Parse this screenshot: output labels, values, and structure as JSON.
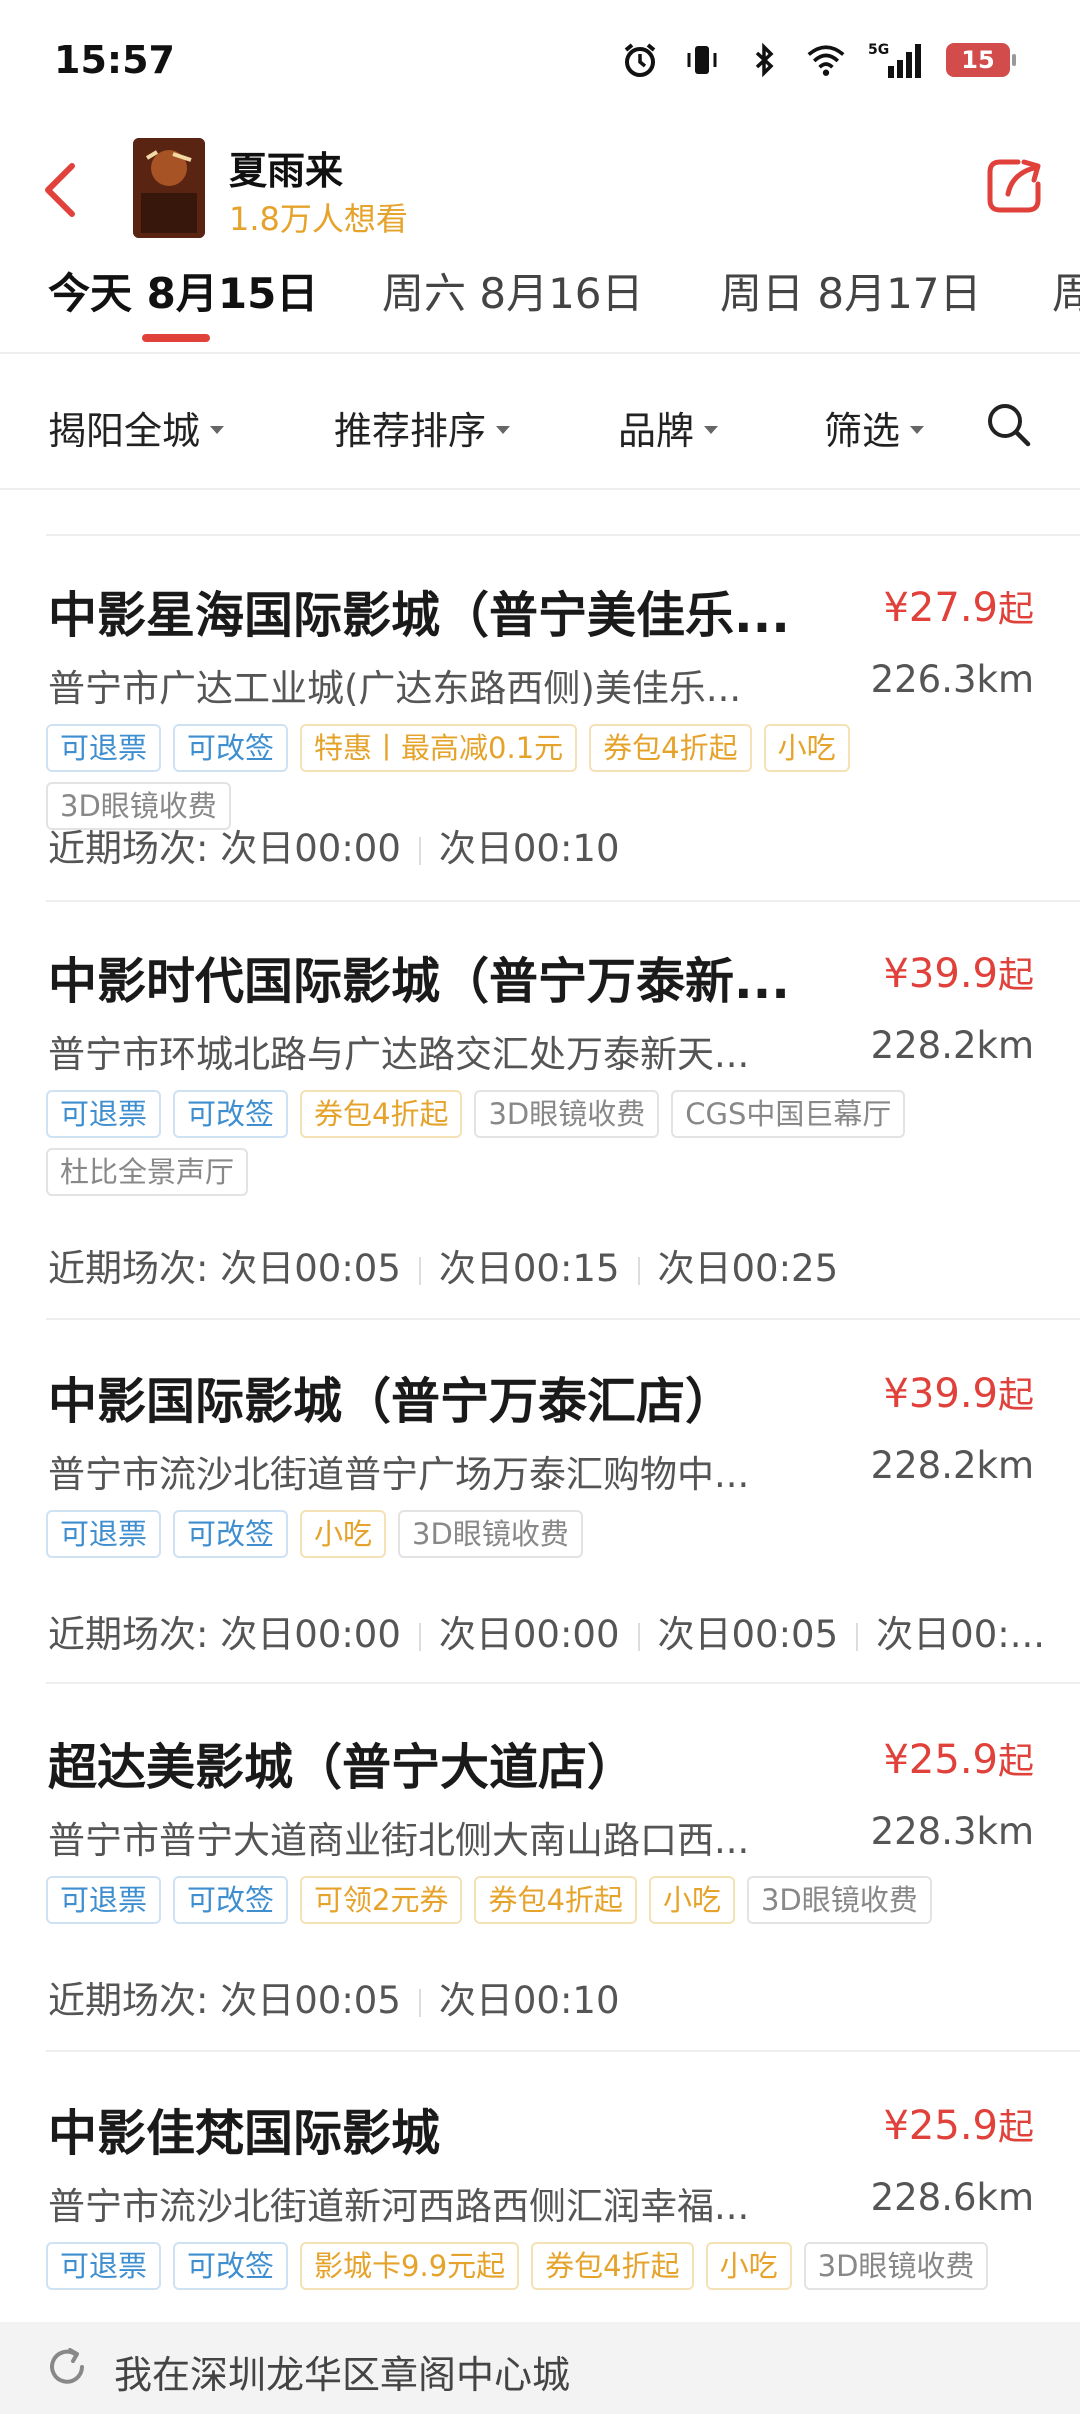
{
  "status_bar": {
    "time": "15:57",
    "battery": "15",
    "icons": [
      "alarm-icon",
      "vibrate-icon",
      "bluetooth-icon",
      "wifi-icon",
      "signal-5g-icon",
      "battery-icon"
    ]
  },
  "header": {
    "title": "夏雨来",
    "want_count": "1.8万人想看",
    "accent_color": "#e0413a"
  },
  "date_tabs": [
    {
      "label": "今天 8月15日",
      "active": true
    },
    {
      "label": "周六 8月16日",
      "active": false
    },
    {
      "label": "周日 8月17日",
      "active": false
    },
    {
      "label": "周",
      "active": false
    }
  ],
  "filters": {
    "area": "揭阳全城",
    "sort": "推荐排序",
    "brand": "品牌",
    "screen": "筛选"
  },
  "cinemas": [
    {
      "name": "中影星海国际影城（普宁美佳乐...",
      "price": "¥27.9",
      "price_suffix": "起",
      "address": "普宁市广达工业城(广达东路西侧)美佳乐...",
      "distance": "226.3km",
      "tags": [
        {
          "text": "可退票",
          "color": "blue"
        },
        {
          "text": "可改签",
          "color": "blue"
        },
        {
          "text": "特惠丨最高减0.1元",
          "color": "orange"
        },
        {
          "text": "券包4折起",
          "color": "orange"
        },
        {
          "text": "小吃",
          "color": "orange"
        },
        {
          "text": "3D眼镜收费",
          "color": "gray"
        }
      ],
      "sessions_label": "近期场次:",
      "sessions": [
        "次日00:00",
        "次日00:10"
      ]
    },
    {
      "name": "中影时代国际影城（普宁万泰新...",
      "price": "¥39.9",
      "price_suffix": "起",
      "address": "普宁市环城北路与广达路交汇处万泰新天...",
      "distance": "228.2km",
      "tags": [
        {
          "text": "可退票",
          "color": "blue"
        },
        {
          "text": "可改签",
          "color": "blue"
        },
        {
          "text": "券包4折起",
          "color": "orange"
        },
        {
          "text": "3D眼镜收费",
          "color": "gray"
        },
        {
          "text": "CGS中国巨幕厅",
          "color": "gray"
        },
        {
          "text": "杜比全景声厅",
          "color": "gray"
        }
      ],
      "sessions_label": "近期场次:",
      "sessions": [
        "次日00:05",
        "次日00:15",
        "次日00:25"
      ]
    },
    {
      "name": "中影国际影城（普宁万泰汇店）",
      "price": "¥39.9",
      "price_suffix": "起",
      "address": "普宁市流沙北街道普宁广场万泰汇购物中...",
      "distance": "228.2km",
      "tags": [
        {
          "text": "可退票",
          "color": "blue"
        },
        {
          "text": "可改签",
          "color": "blue"
        },
        {
          "text": "小吃",
          "color": "orange"
        },
        {
          "text": "3D眼镜收费",
          "color": "gray"
        }
      ],
      "sessions_label": "近期场次:",
      "sessions": [
        "次日00:00",
        "次日00:00",
        "次日00:05",
        "次日00:..."
      ]
    },
    {
      "name": "超达美影城（普宁大道店）",
      "price": "¥25.9",
      "price_suffix": "起",
      "address": "普宁市普宁大道商业街北侧大南山路口西...",
      "distance": "228.3km",
      "tags": [
        {
          "text": "可退票",
          "color": "blue"
        },
        {
          "text": "可改签",
          "color": "blue"
        },
        {
          "text": "可领2元券",
          "color": "orange"
        },
        {
          "text": "券包4折起",
          "color": "orange"
        },
        {
          "text": "小吃",
          "color": "orange"
        },
        {
          "text": "3D眼镜收费",
          "color": "gray"
        }
      ],
      "sessions_label": "近期场次:",
      "sessions": [
        "次日00:05",
        "次日00:10"
      ]
    },
    {
      "name": "中影佳梵国际影城",
      "price": "¥25.9",
      "price_suffix": "起",
      "address": "普宁市流沙北街道新河西路西侧汇润幸福...",
      "distance": "228.6km",
      "tags": [
        {
          "text": "可退票",
          "color": "blue"
        },
        {
          "text": "可改签",
          "color": "blue"
        },
        {
          "text": "影城卡9.9元起",
          "color": "orange"
        },
        {
          "text": "券包4折起",
          "color": "orange"
        },
        {
          "text": "小吃",
          "color": "orange"
        },
        {
          "text": "3D眼镜收费",
          "color": "gray"
        }
      ],
      "sessions_label": "",
      "sessions": []
    }
  ],
  "location_bar": {
    "text": "我在深圳龙华区章阁中心城"
  }
}
